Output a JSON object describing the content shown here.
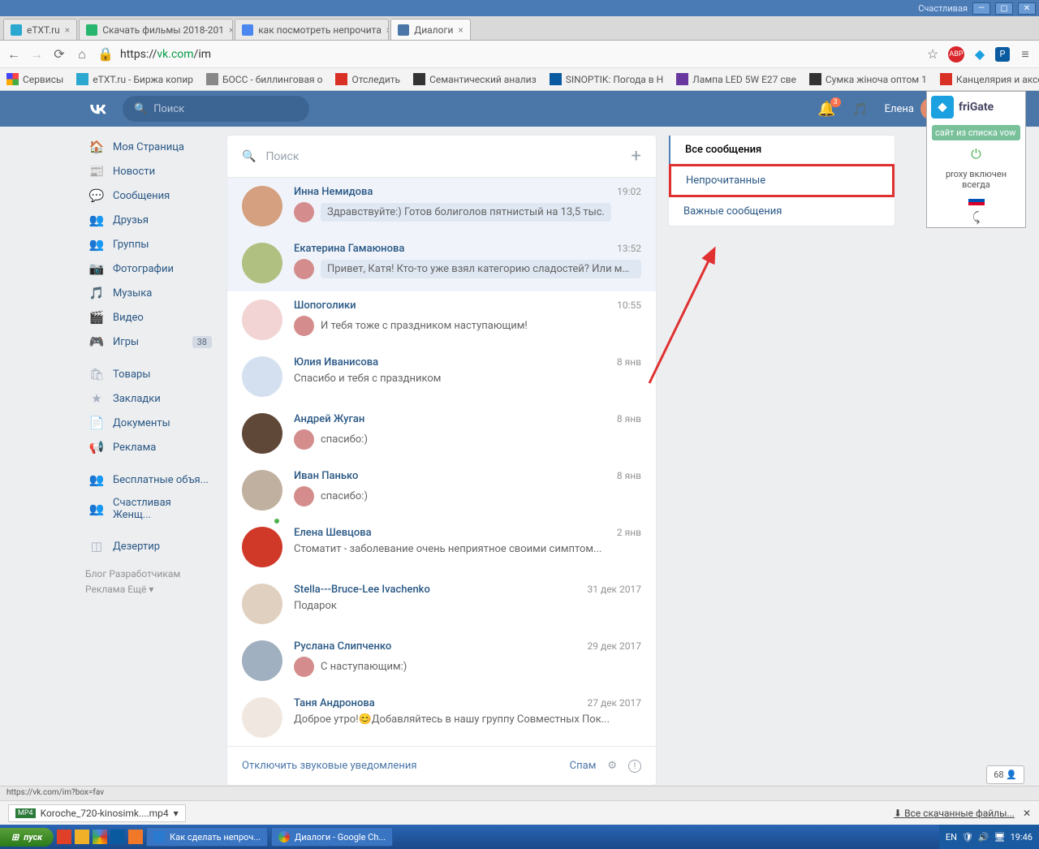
{
  "window": {
    "user_label": "Счастливая"
  },
  "tabs": [
    {
      "label": "eTXT.ru",
      "fav": "#2aa8d0"
    },
    {
      "label": "Скачать фильмы 2018-201",
      "fav": "#28b66f"
    },
    {
      "label": "как посмотреть непрочита",
      "fav": "#4a87ee"
    },
    {
      "label": "Диалоги",
      "fav": "#4a76a8",
      "active": true
    }
  ],
  "url": {
    "pre": "https://",
    "host": "vk.com",
    "path": "/im"
  },
  "bookmarks": [
    "Сервисы",
    "eTXT.ru - Биржа копир",
    "БОСС - биллинговая о",
    "Отследить",
    "Семантический анализ",
    "SINOPTIK: Погода в Н",
    "Лампа LED 5W E27 све",
    "Сумка жіноча оптом 1",
    "Канцелярия и аксессу"
  ],
  "vk": {
    "search_ph": "Поиск",
    "badge": "3",
    "user": "Елена",
    "side": [
      {
        "i": "🏠",
        "t": "Моя Страница"
      },
      {
        "i": "📰",
        "t": "Новости"
      },
      {
        "i": "💬",
        "t": "Сообщения"
      },
      {
        "i": "👥",
        "t": "Друзья"
      },
      {
        "i": "👥",
        "t": "Группы"
      },
      {
        "i": "📷",
        "t": "Фотографии"
      },
      {
        "i": "🎵",
        "t": "Музыка"
      },
      {
        "i": "🎬",
        "t": "Видео"
      },
      {
        "i": "🎮",
        "t": "Игры",
        "c": "38"
      }
    ],
    "side2": [
      {
        "i": "🛍",
        "t": "Товары"
      },
      {
        "i": "★",
        "t": "Закладки"
      },
      {
        "i": "📄",
        "t": "Документы"
      },
      {
        "i": "📢",
        "t": "Реклама"
      }
    ],
    "side3": [
      {
        "i": "👥",
        "t": "Бесплатные объя..."
      },
      {
        "i": "👥",
        "t": "Счастливая Женщ..."
      }
    ],
    "side4": [
      {
        "i": "◫",
        "t": "Дезертир"
      }
    ],
    "foot": "Блог   Разработчикам\nРеклама   Ещё ▾",
    "msearch_ph": "Поиск",
    "dialogs": [
      {
        "n": "Инна Немидова",
        "t": "19:02",
        "p": "Здравствуйте:) Готов болиголов пятнистый на 13,5 тыс.",
        "u": true,
        "mini": true,
        "c": "#d4a080"
      },
      {
        "n": "Екатерина Гамаюнова",
        "t": "13:52",
        "p": "Привет, Катя! Кто-то уже взял категорию сладостей? Или можн...",
        "u": true,
        "mini": true,
        "c": "#b0c080"
      },
      {
        "n": "Шопоголики",
        "t": "10:55",
        "p": "И тебя тоже с праздником наступающим!",
        "mini": true,
        "c": "#f2d4d4"
      },
      {
        "n": "Юлия Иванисова",
        "t": "8 янв",
        "p": "Спасибо и тебя с праздником",
        "c": "#d4e0f0"
      },
      {
        "n": "Андрей Жуган",
        "t": "8 янв",
        "p": "спасибо:)",
        "mini": true,
        "c": "#604838"
      },
      {
        "n": "Иван Панько",
        "t": "8 янв",
        "p": "спасибо:)",
        "mini": true,
        "c": "#c0b0a0"
      },
      {
        "n": "Елена Шевцова",
        "t": "2 янв",
        "p": "Стоматит - заболевание очень неприятное своими симптом...",
        "c": "#d03828",
        "online": true
      },
      {
        "n": "Stella---Bruce-Lee Ivachenko",
        "t": "31 дек 2017",
        "p": "Подарок",
        "c": "#e0d0c0"
      },
      {
        "n": "Руслана Слипченко",
        "t": "29 дек 2017",
        "p": "С наступающим:)",
        "mini": true,
        "c": "#a0b0c0"
      },
      {
        "n": "Таня Андронова",
        "t": "27 дек 2017",
        "p": "Доброе утро!😊Добавляйтесь в нашу группу Совместных Пок...",
        "c": "#f0e8e0"
      }
    ],
    "disable_sound": "Отключить звуковые уведомления",
    "spam": "Спам",
    "filters": [
      "Все сообщения",
      "Непрочитанные",
      "Важные сообщения"
    ]
  },
  "frigate": {
    "title": "friGate",
    "btn": "сайт из списка vow",
    "txt": "proxy включен всегда"
  },
  "download": {
    "file": "Koroche_720-kinosimk....mp4",
    "all": "Все скачанные файлы..."
  },
  "status_url": "https://vk.com/im?box=fav",
  "taskbar": {
    "start": "пуск",
    "items": [
      "Как сделать непроч...",
      "Диалоги - Google Ch..."
    ],
    "lang": "EN",
    "time": "19:46"
  },
  "popup": "68 👤"
}
